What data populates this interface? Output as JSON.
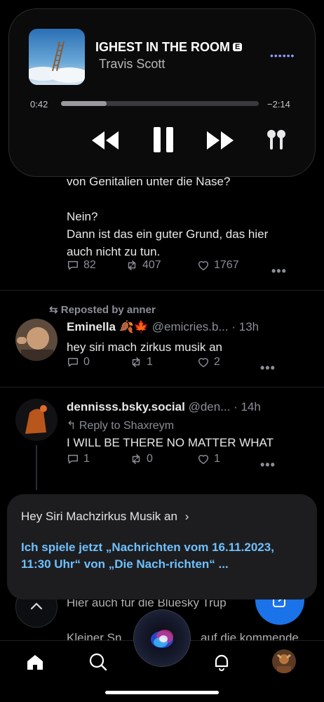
{
  "media_player": {
    "song_title": "IGHEST IN THE ROOM",
    "explicit_badge": "E",
    "artist": "Travis Scott",
    "elapsed": "0:42",
    "remaining": "−2:14",
    "progress": 0.23
  },
  "posts": [
    {
      "text_lines": [
        "von Genitalien unter die Nase?",
        "",
        "Nein?",
        "Dann ist das ein guter Grund, das hier",
        "auch nicht zu tun."
      ],
      "replies": "82",
      "reposts": "407",
      "likes": "1767"
    },
    {
      "repost_label": "Reposted by anner",
      "name": "Eminella",
      "handle": "@emicries.b...",
      "time": "· 13h",
      "text": "hey siri mach zirkus musik an",
      "replies": "0",
      "reposts": "1",
      "likes": "2"
    },
    {
      "name": "dennisss.bsky.social",
      "handle": "@den...",
      "time": "· 14h",
      "reply_to": "Reply to Shaxreym",
      "text": "I WILL BE THERE NO MATTER WHAT",
      "replies": "1",
      "reposts": "0",
      "likes": "1"
    }
  ],
  "background_fragments": {
    "line1": "Hier auch für die Bluesky Trup",
    "line2": "Kleiner Sn",
    "line3": "auf die kommende"
  },
  "siri": {
    "query": "Hey Siri Machzirkus Musik an",
    "answer": "Ich spiele jetzt „Nachrichten vom 16.11.2023, 11:30 Uhr“ von „Die Nach-richten“ ..."
  },
  "colors": {
    "accent_blue": "#1a73e8",
    "siri_text": "#6ec1ff",
    "muted": "#8b8e96"
  }
}
